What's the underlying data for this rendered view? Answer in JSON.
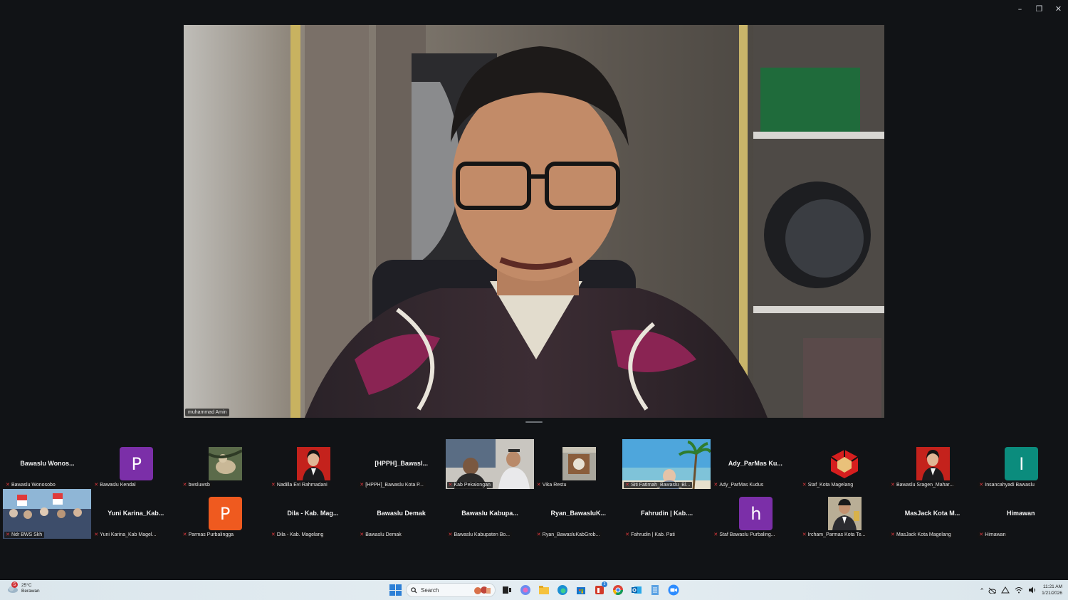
{
  "window": {
    "controls": {
      "minimize": "–",
      "restore": "❐",
      "close": "✕"
    }
  },
  "speaker": {
    "name": "muhammad Amin"
  },
  "gallery": {
    "row1": [
      {
        "label": "Bawaslu Wonosobo",
        "bigname": "Bawaslu  Wonos...",
        "kind": "name"
      },
      {
        "label": "Bawaslu Kendal",
        "avatar": "P",
        "color": "#7b2fa8",
        "kind": "avatar"
      },
      {
        "label": "bwsluwsb",
        "kind": "photo",
        "photo": "deer"
      },
      {
        "label": "Nadilla Evi Rahmadani",
        "kind": "photo",
        "photo": "portrait-red"
      },
      {
        "label": "[HPPH]_Bawaslu Kota P...",
        "bigname": "[HPPH]_Bawasl...",
        "kind": "name"
      },
      {
        "label": "Kab Pekalongan",
        "kind": "video",
        "photo": "two-men"
      },
      {
        "label": "Vika Restu",
        "kind": "photo",
        "photo": "room"
      },
      {
        "label": "Siti Fatimah_Bawaslu_Bl...",
        "kind": "video",
        "photo": "beach"
      },
      {
        "label": "Ady_ParMas Kudus",
        "bigname": "Ady_ParMas  Ku...",
        "kind": "name"
      },
      {
        "label": "Staf_Kota Magelang",
        "kind": "photo",
        "photo": "logo-red"
      },
      {
        "label": "Bawaslu Sragen_Mahar...",
        "kind": "photo",
        "photo": "portrait-red"
      },
      {
        "label": "Insancahyadi Bawaslu",
        "avatar": "I",
        "color": "#0b8c7d",
        "kind": "avatar"
      }
    ],
    "row2": [
      {
        "label": "Ndr BWS Skh",
        "kind": "video",
        "photo": "crowd"
      },
      {
        "label": "Yuni Karina_Kab Magel...",
        "bigname": "Yuni  Karina_Kab...",
        "kind": "name"
      },
      {
        "label": "Parmas Purbalingga",
        "avatar": "P",
        "color": "#ef5a1f",
        "kind": "avatar"
      },
      {
        "label": "Dila - Kab. Magelang",
        "bigname": "Dila - Kab. Mag...",
        "kind": "name"
      },
      {
        "label": "Bawaslu Demak",
        "bigname": "Bawaslu Demak",
        "kind": "name"
      },
      {
        "label": "Bawaslu Kabupaten Bo...",
        "bigname": "Bawaslu  Kabupa...",
        "kind": "name"
      },
      {
        "label": "Ryan_BawasluKabGrob...",
        "bigname": "Ryan_BawasluK...",
        "kind": "name"
      },
      {
        "label": "Fahrudin | Kab. Pati",
        "bigname": "Fahrudin | Kab....",
        "kind": "name"
      },
      {
        "label": "Staf Bawaslu Purbaling...",
        "avatar": "h",
        "color": "#7b2fa8",
        "kind": "avatar"
      },
      {
        "label": "Ircham_Parmas Kota Te...",
        "kind": "photo",
        "photo": "person-suit"
      },
      {
        "label": "MasJack Kota Magelang",
        "bigname": "MasJack Kota M...",
        "kind": "name"
      },
      {
        "label": "Himawan",
        "bigname": "Himawan",
        "kind": "name"
      }
    ]
  },
  "taskbar": {
    "weather": {
      "temp": "25°C",
      "desc": "Berawan",
      "badge": "5"
    },
    "search_placeholder": "Search",
    "apps": [
      "file-explorer",
      "copilot",
      "folder",
      "edge",
      "store",
      "office",
      "chrome",
      "outlook",
      "notepad",
      "zoom"
    ],
    "office_badge": "3",
    "clock": {
      "time": "11:21 AM",
      "date": "1/21/2026"
    }
  }
}
